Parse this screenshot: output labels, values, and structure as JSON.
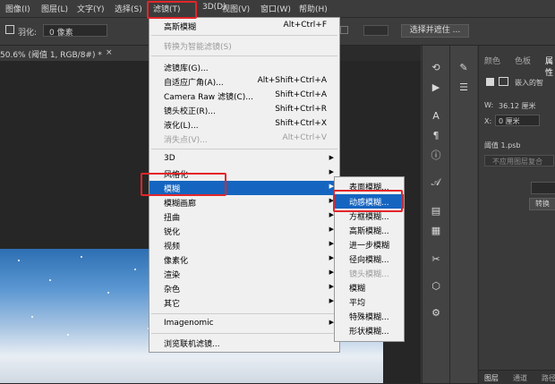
{
  "menubar": {
    "items": [
      {
        "label": "图像(I)"
      },
      {
        "label": "图层(L)"
      },
      {
        "label": "文字(Y)"
      },
      {
        "label": "选择(S)"
      },
      {
        "label": "滤镜(T)"
      },
      {
        "label": "3D(D)"
      },
      {
        "label": "视图(V)"
      },
      {
        "label": "窗口(W)"
      },
      {
        "label": "帮助(H)"
      }
    ]
  },
  "options": {
    "feather_label": "羽化:",
    "feather_value": "0 像素",
    "select_mask_button": "选择并遮住 ..."
  },
  "document_tab": {
    "title": "50.6% (阈值 1, RGB/8#) *"
  },
  "filter_menu": {
    "items": [
      {
        "label": "高斯模糊",
        "shortcut": "Alt+Ctrl+F"
      },
      {
        "label": "转换为智能滤镜(S)",
        "shortcut": ""
      },
      {
        "label": "滤镜库(G)...",
        "shortcut": ""
      },
      {
        "label": "自适应广角(A)...",
        "shortcut": "Alt+Shift+Ctrl+A"
      },
      {
        "label": "Camera Raw 滤镜(C)...",
        "shortcut": "Shift+Ctrl+A"
      },
      {
        "label": "镜头校正(R)...",
        "shortcut": "Shift+Ctrl+R"
      },
      {
        "label": "液化(L)...",
        "shortcut": "Shift+Ctrl+X"
      },
      {
        "label": "消失点(V)...",
        "shortcut": "Alt+Ctrl+V"
      },
      {
        "label": "3D",
        "shortcut": ""
      },
      {
        "label": "风格化",
        "shortcut": ""
      },
      {
        "label": "模糊",
        "shortcut": ""
      },
      {
        "label": "模糊画廊",
        "shortcut": ""
      },
      {
        "label": "扭曲",
        "shortcut": ""
      },
      {
        "label": "锐化",
        "shortcut": ""
      },
      {
        "label": "视频",
        "shortcut": ""
      },
      {
        "label": "像素化",
        "shortcut": ""
      },
      {
        "label": "渲染",
        "shortcut": ""
      },
      {
        "label": "杂色",
        "shortcut": ""
      },
      {
        "label": "其它",
        "shortcut": ""
      },
      {
        "label": "Imagenomic",
        "shortcut": ""
      },
      {
        "label": "浏览联机滤镜...",
        "shortcut": ""
      }
    ]
  },
  "blur_submenu": {
    "items": [
      {
        "label": "表面模糊..."
      },
      {
        "label": "动感模糊..."
      },
      {
        "label": "方框模糊..."
      },
      {
        "label": "高斯模糊..."
      },
      {
        "label": "进一步模糊"
      },
      {
        "label": "径向模糊..."
      },
      {
        "label": "镜头模糊..."
      },
      {
        "label": "模糊"
      },
      {
        "label": "平均"
      },
      {
        "label": "特殊模糊..."
      },
      {
        "label": "形状模糊..."
      }
    ]
  },
  "right_panel": {
    "tabs": [
      "颜色",
      "色板",
      "属性"
    ],
    "embedded_label": "嵌入的智",
    "width_label": "W:",
    "width_value": "36.12 厘米",
    "x_label": "X:",
    "x_value": "0 厘米",
    "layer_name": "阈值 1.psb",
    "comp_placeholder": "不应用图层复合",
    "convert_button": "转换",
    "bottom_tabs": [
      "图层",
      "通道",
      "路径"
    ]
  },
  "colors": {
    "highlight": "#1565c0",
    "annotation": "#e3262a"
  }
}
